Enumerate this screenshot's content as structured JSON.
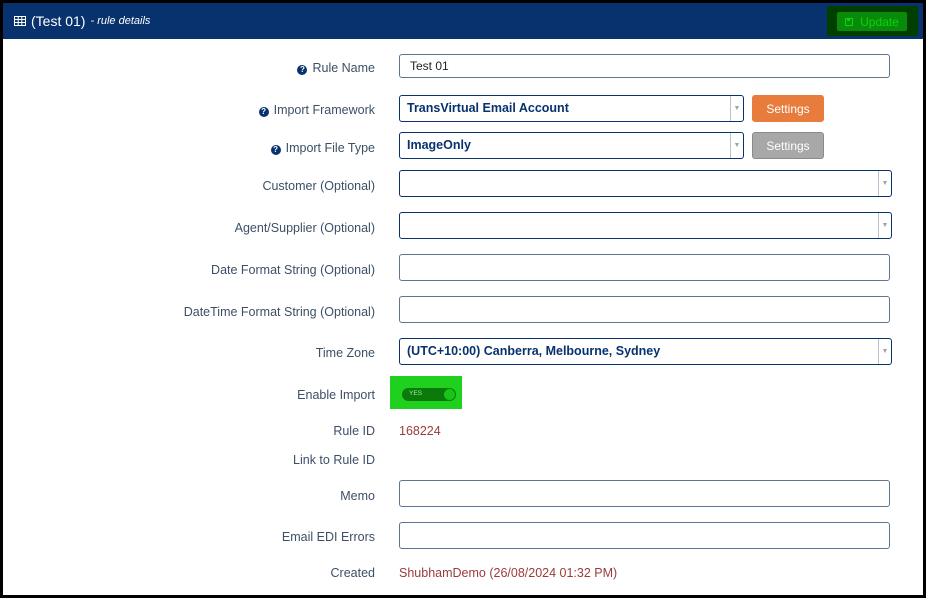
{
  "header": {
    "title": "(Test 01)",
    "subtitle": "- rule details",
    "update_label": "Update"
  },
  "form": {
    "rule_name": {
      "label": "Rule Name",
      "value": "Test 01"
    },
    "import_framework": {
      "label": "Import Framework",
      "value": "TransVirtual Email Account",
      "settings_label": "Settings"
    },
    "import_file_type": {
      "label": "Import File Type",
      "value": "ImageOnly",
      "settings_label": "Settings"
    },
    "customer": {
      "label": "Customer (Optional)",
      "value": ""
    },
    "agent_supplier": {
      "label": "Agent/Supplier (Optional)",
      "value": ""
    },
    "date_format": {
      "label": "Date Format String (Optional)",
      "value": ""
    },
    "datetime_format": {
      "label": "DateTime Format String (Optional)",
      "value": ""
    },
    "time_zone": {
      "label": "Time Zone",
      "value": "(UTC+10:00) Canberra, Melbourne, Sydney"
    },
    "enable_import": {
      "label": "Enable Import",
      "toggle_text": "YES",
      "on": true
    },
    "rule_id": {
      "label": "Rule ID",
      "value": "168224"
    },
    "link_rule_id": {
      "label": "Link to Rule ID",
      "value": ""
    },
    "memo": {
      "label": "Memo",
      "value": ""
    },
    "email_edi_errors": {
      "label": "Email EDI Errors",
      "value": ""
    },
    "created": {
      "label": "Created",
      "value": "ShubhamDemo (26/08/2024 01:32 PM)"
    }
  },
  "colors": {
    "header_bg": "#07326e",
    "accent_orange": "#e77c3c",
    "toggle_green": "#1fd01f",
    "value_red": "#9b3b3b"
  },
  "icons": {
    "title": "table-icon",
    "update": "save-icon",
    "help": "question-circle-icon",
    "dropdown": "caret-down-icon"
  }
}
